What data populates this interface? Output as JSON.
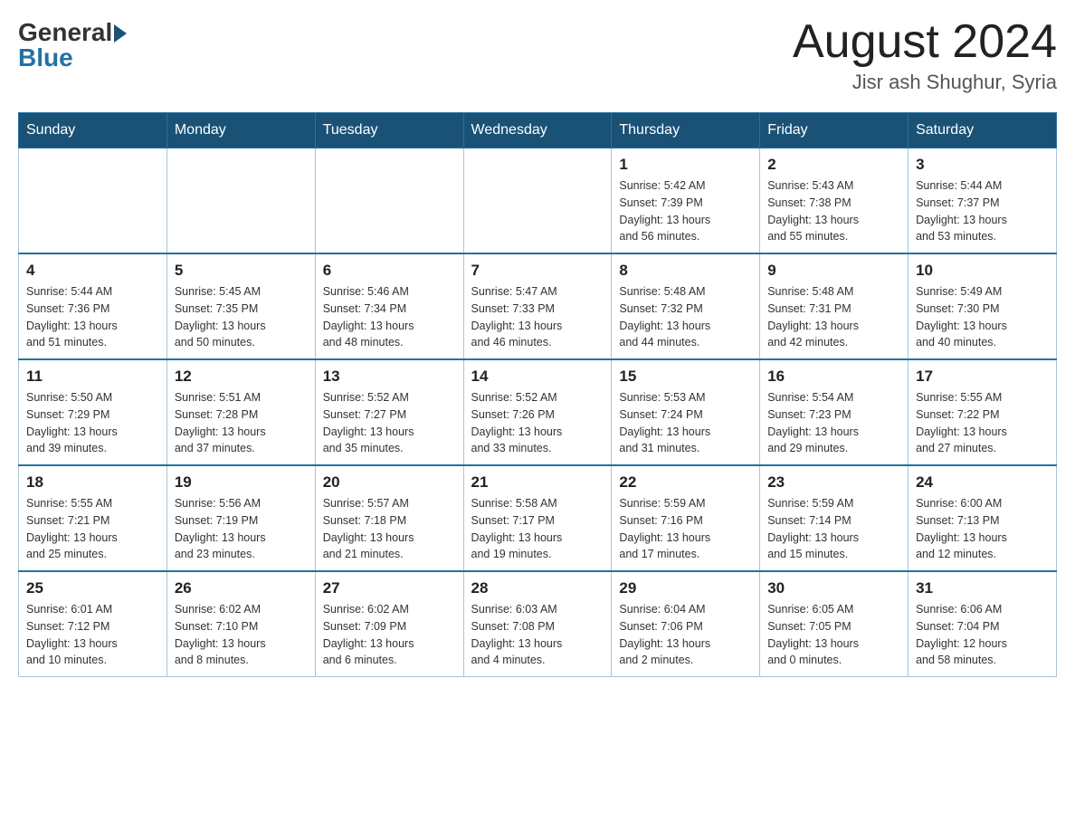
{
  "header": {
    "logo_general": "General",
    "logo_blue": "Blue",
    "month_year": "August 2024",
    "location": "Jisr ash Shughur, Syria"
  },
  "days_of_week": [
    "Sunday",
    "Monday",
    "Tuesday",
    "Wednesday",
    "Thursday",
    "Friday",
    "Saturday"
  ],
  "weeks": [
    [
      {
        "day": "",
        "info": ""
      },
      {
        "day": "",
        "info": ""
      },
      {
        "day": "",
        "info": ""
      },
      {
        "day": "",
        "info": ""
      },
      {
        "day": "1",
        "info": "Sunrise: 5:42 AM\nSunset: 7:39 PM\nDaylight: 13 hours\nand 56 minutes."
      },
      {
        "day": "2",
        "info": "Sunrise: 5:43 AM\nSunset: 7:38 PM\nDaylight: 13 hours\nand 55 minutes."
      },
      {
        "day": "3",
        "info": "Sunrise: 5:44 AM\nSunset: 7:37 PM\nDaylight: 13 hours\nand 53 minutes."
      }
    ],
    [
      {
        "day": "4",
        "info": "Sunrise: 5:44 AM\nSunset: 7:36 PM\nDaylight: 13 hours\nand 51 minutes."
      },
      {
        "day": "5",
        "info": "Sunrise: 5:45 AM\nSunset: 7:35 PM\nDaylight: 13 hours\nand 50 minutes."
      },
      {
        "day": "6",
        "info": "Sunrise: 5:46 AM\nSunset: 7:34 PM\nDaylight: 13 hours\nand 48 minutes."
      },
      {
        "day": "7",
        "info": "Sunrise: 5:47 AM\nSunset: 7:33 PM\nDaylight: 13 hours\nand 46 minutes."
      },
      {
        "day": "8",
        "info": "Sunrise: 5:48 AM\nSunset: 7:32 PM\nDaylight: 13 hours\nand 44 minutes."
      },
      {
        "day": "9",
        "info": "Sunrise: 5:48 AM\nSunset: 7:31 PM\nDaylight: 13 hours\nand 42 minutes."
      },
      {
        "day": "10",
        "info": "Sunrise: 5:49 AM\nSunset: 7:30 PM\nDaylight: 13 hours\nand 40 minutes."
      }
    ],
    [
      {
        "day": "11",
        "info": "Sunrise: 5:50 AM\nSunset: 7:29 PM\nDaylight: 13 hours\nand 39 minutes."
      },
      {
        "day": "12",
        "info": "Sunrise: 5:51 AM\nSunset: 7:28 PM\nDaylight: 13 hours\nand 37 minutes."
      },
      {
        "day": "13",
        "info": "Sunrise: 5:52 AM\nSunset: 7:27 PM\nDaylight: 13 hours\nand 35 minutes."
      },
      {
        "day": "14",
        "info": "Sunrise: 5:52 AM\nSunset: 7:26 PM\nDaylight: 13 hours\nand 33 minutes."
      },
      {
        "day": "15",
        "info": "Sunrise: 5:53 AM\nSunset: 7:24 PM\nDaylight: 13 hours\nand 31 minutes."
      },
      {
        "day": "16",
        "info": "Sunrise: 5:54 AM\nSunset: 7:23 PM\nDaylight: 13 hours\nand 29 minutes."
      },
      {
        "day": "17",
        "info": "Sunrise: 5:55 AM\nSunset: 7:22 PM\nDaylight: 13 hours\nand 27 minutes."
      }
    ],
    [
      {
        "day": "18",
        "info": "Sunrise: 5:55 AM\nSunset: 7:21 PM\nDaylight: 13 hours\nand 25 minutes."
      },
      {
        "day": "19",
        "info": "Sunrise: 5:56 AM\nSunset: 7:19 PM\nDaylight: 13 hours\nand 23 minutes."
      },
      {
        "day": "20",
        "info": "Sunrise: 5:57 AM\nSunset: 7:18 PM\nDaylight: 13 hours\nand 21 minutes."
      },
      {
        "day": "21",
        "info": "Sunrise: 5:58 AM\nSunset: 7:17 PM\nDaylight: 13 hours\nand 19 minutes."
      },
      {
        "day": "22",
        "info": "Sunrise: 5:59 AM\nSunset: 7:16 PM\nDaylight: 13 hours\nand 17 minutes."
      },
      {
        "day": "23",
        "info": "Sunrise: 5:59 AM\nSunset: 7:14 PM\nDaylight: 13 hours\nand 15 minutes."
      },
      {
        "day": "24",
        "info": "Sunrise: 6:00 AM\nSunset: 7:13 PM\nDaylight: 13 hours\nand 12 minutes."
      }
    ],
    [
      {
        "day": "25",
        "info": "Sunrise: 6:01 AM\nSunset: 7:12 PM\nDaylight: 13 hours\nand 10 minutes."
      },
      {
        "day": "26",
        "info": "Sunrise: 6:02 AM\nSunset: 7:10 PM\nDaylight: 13 hours\nand 8 minutes."
      },
      {
        "day": "27",
        "info": "Sunrise: 6:02 AM\nSunset: 7:09 PM\nDaylight: 13 hours\nand 6 minutes."
      },
      {
        "day": "28",
        "info": "Sunrise: 6:03 AM\nSunset: 7:08 PM\nDaylight: 13 hours\nand 4 minutes."
      },
      {
        "day": "29",
        "info": "Sunrise: 6:04 AM\nSunset: 7:06 PM\nDaylight: 13 hours\nand 2 minutes."
      },
      {
        "day": "30",
        "info": "Sunrise: 6:05 AM\nSunset: 7:05 PM\nDaylight: 13 hours\nand 0 minutes."
      },
      {
        "day": "31",
        "info": "Sunrise: 6:06 AM\nSunset: 7:04 PM\nDaylight: 12 hours\nand 58 minutes."
      }
    ]
  ]
}
